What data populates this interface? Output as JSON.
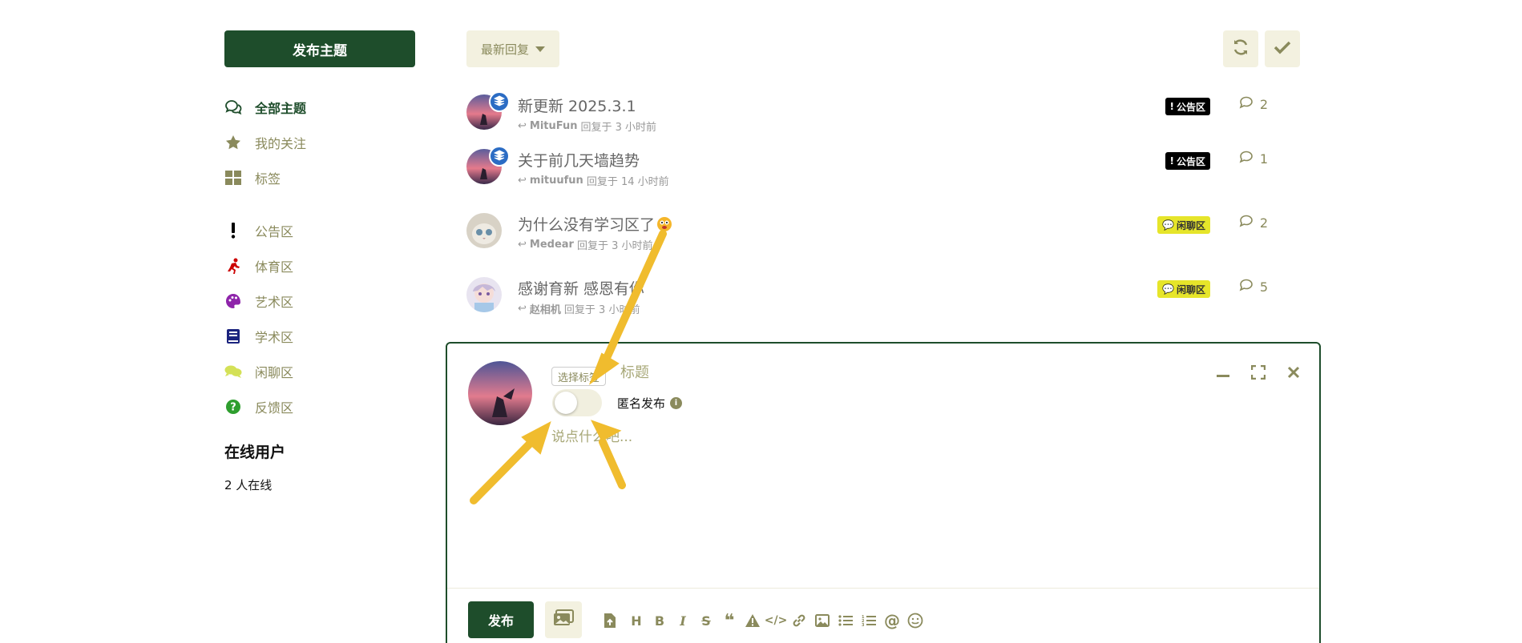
{
  "sidebar": {
    "start_button": "发布主题",
    "nav": [
      {
        "label": "全部主题",
        "icon": "comments-icon",
        "active": true
      },
      {
        "label": "我的关注",
        "icon": "star-icon",
        "active": false
      },
      {
        "label": "标签",
        "icon": "grid-icon",
        "active": false
      }
    ],
    "tags": [
      {
        "label": "公告区",
        "icon": "exclamation-icon",
        "color": "#000000"
      },
      {
        "label": "体育区",
        "icon": "running-icon",
        "color": "#cc0000"
      },
      {
        "label": "艺术区",
        "icon": "palette-icon",
        "color": "#8e24aa"
      },
      {
        "label": "学术区",
        "icon": "book-icon",
        "color": "#1a237e"
      },
      {
        "label": "闲聊区",
        "icon": "chat-icon",
        "color": "#d4e157"
      },
      {
        "label": "反馈区",
        "icon": "question-icon",
        "color": "#2e9e2e"
      }
    ],
    "online_title": "在线用户",
    "online_count": "2 人在线"
  },
  "toolbar": {
    "sort_label": "最新回复",
    "refresh_icon": "refresh-icon",
    "mark_read_icon": "check-icon"
  },
  "topics": [
    {
      "title": "新更新 2025.3.1",
      "user": "MituFun",
      "time": "回复于 3 小时前",
      "tag": "公告区",
      "tag_type": "notice",
      "replies": "2",
      "pinned": true
    },
    {
      "title": "关于前几天墙趋势",
      "user": "mituufun",
      "time": "回复于 14 小时前",
      "tag": "公告区",
      "tag_type": "notice",
      "replies": "1",
      "pinned": true
    },
    {
      "title": "为什么没有学习区了",
      "user": "Medear",
      "time": "回复于 3 小时前",
      "tag": "闲聊区",
      "tag_type": "chat",
      "replies": "2",
      "pinned": false
    },
    {
      "title": "感谢育新 感恩有你",
      "user": "赵相机",
      "time": "回复于 3 小时前",
      "tag": "闲聊区",
      "tag_type": "chat",
      "replies": "5",
      "pinned": false
    }
  ],
  "composer": {
    "tag_select": "选择标签",
    "title_placeholder": "标题",
    "anon_label": "匿名发布",
    "body_placeholder": "说点什么吧...",
    "publish_label": "发布",
    "toolbar_icons": [
      "upload-icon",
      "heading-icon",
      "bold-icon",
      "italic-icon",
      "strikethrough-icon",
      "quote-icon",
      "warning-icon",
      "code-icon",
      "link-icon",
      "image-icon",
      "bullet-list-icon",
      "numbered-list-icon",
      "mention-icon",
      "emoji-icon"
    ]
  },
  "colors": {
    "primary": "#1e4d2b",
    "muted": "#8a8a5c",
    "soft_bg": "#f3f1e0",
    "arrow": "#f0bc2e"
  }
}
